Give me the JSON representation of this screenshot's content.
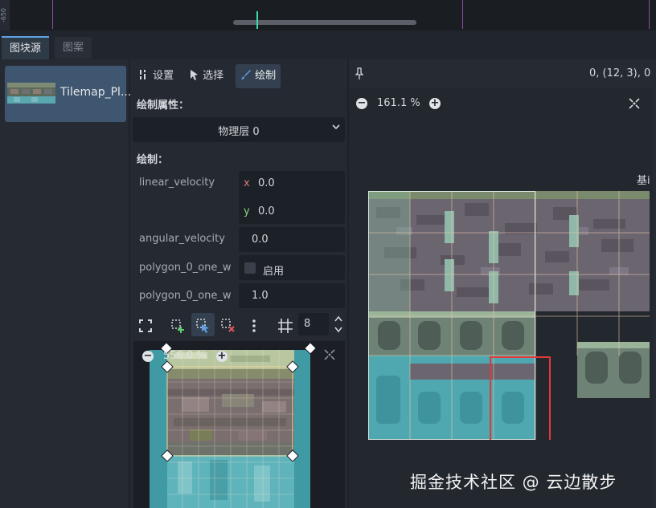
{
  "viewport": {
    "ruler_label": "-650"
  },
  "tabs": [
    {
      "label": "图块源",
      "active": true
    },
    {
      "label": "图案",
      "active": false
    }
  ],
  "sources": [
    {
      "label": "Tilemap_Pl..."
    }
  ],
  "toolbar": {
    "settings_label": "设置",
    "select_label": "选择",
    "paint_label": "绘制"
  },
  "paint": {
    "properties_title": "绘制属性：",
    "layer_selected": "物理层 0",
    "paint_title": "绘制：",
    "properties": [
      {
        "label": "linear_velocity",
        "x": "0.0",
        "y": "0.0"
      },
      {
        "label": "angular_velocity",
        "value": "0.0"
      },
      {
        "label": "polygon_0_one_w",
        "checkbox_label": "启用",
        "checked": false
      },
      {
        "label": "polygon_0_one_w",
        "value": "1.0"
      }
    ],
    "axis_x": "x",
    "axis_y": "y",
    "snap_steps": "8",
    "editor_zoom": "556.0 %"
  },
  "atlas": {
    "coords": "0, (12, 3), 0",
    "zoom": "161.1 %",
    "base_label": "基i"
  },
  "watermark": "掘金技术社区 @ 云边散步",
  "colors": {
    "accent": "#5fa0e6",
    "selection_red": "#e03a3a",
    "active_tab": "#3f5670"
  }
}
